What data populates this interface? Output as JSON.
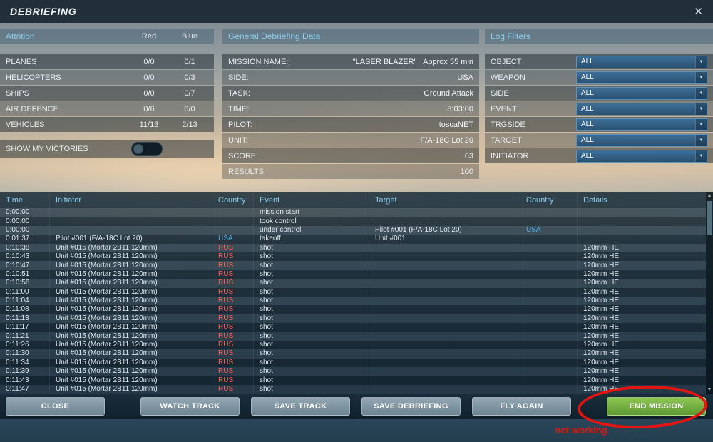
{
  "window": {
    "title": "DEBRIEFING",
    "close_icon": "✕"
  },
  "attrition": {
    "header": "Attrition",
    "columns": {
      "red": "Red",
      "blue": "Blue"
    },
    "rows": [
      {
        "label": "PLANES",
        "red": "0/0",
        "blue": "0/1"
      },
      {
        "label": "HELICOPTERS",
        "red": "0/0",
        "blue": "0/3"
      },
      {
        "label": "SHIPS",
        "red": "0/0",
        "blue": "0/7"
      },
      {
        "label": "AIR DEFENCE",
        "red": "0/6",
        "blue": "0/0"
      },
      {
        "label": "VEHICLES",
        "red": "11/13",
        "blue": "2/13"
      }
    ],
    "show_my_victories_label": "SHOW MY VICTORIES",
    "show_my_victories_on": false
  },
  "general": {
    "header": "General Debriefing Data",
    "rows": [
      {
        "label": "MISSION NAME:",
        "value": "\"LASER BLAZER\"   Approx 55 min"
      },
      {
        "label": "SIDE:",
        "value": "USA"
      },
      {
        "label": "TASK:",
        "value": "Ground Attack"
      },
      {
        "label": "TIME:",
        "value": "8:03:00"
      },
      {
        "label": "PILOT:",
        "value": "toscaNET"
      },
      {
        "label": "UNIT:",
        "value": "F/A-18C Lot 20"
      },
      {
        "label": "SCORE:",
        "value": "63"
      },
      {
        "label": "RESULTS",
        "value": "100"
      }
    ]
  },
  "log_filters": {
    "header": "Log Filters",
    "dropdown_arrow": "▼",
    "filters": [
      {
        "label": "OBJECT",
        "value": "ALL"
      },
      {
        "label": "WEAPON",
        "value": "ALL"
      },
      {
        "label": "SIDE",
        "value": "ALL"
      },
      {
        "label": "EVENT",
        "value": "ALL"
      },
      {
        "label": "TRGSIDE",
        "value": "ALL"
      },
      {
        "label": "TARGET",
        "value": "ALL"
      },
      {
        "label": "INITIATOR",
        "value": "ALL"
      }
    ]
  },
  "log_table": {
    "columns": [
      "Time",
      "Initiator",
      "Country",
      "Event",
      "Target",
      "Country",
      "Details"
    ],
    "scroll_up_icon": "▲",
    "scroll_down_icon": "▼",
    "rows": [
      [
        "0:00:00",
        "",
        "",
        "mission start",
        "",
        "",
        ""
      ],
      [
        "0:00:00",
        "",
        "",
        "took control",
        "",
        "",
        ""
      ],
      [
        "0:00:00",
        "",
        "",
        "under control",
        "Pilot #001 (F/A-18C Lot 20)",
        "USA",
        ""
      ],
      [
        "0:01:37",
        "Pilot #001 (F/A-18C Lot 20)",
        "USA",
        "takeoff",
        "Unit #001",
        "",
        ""
      ],
      [
        "0:10:38",
        "Unit #015 (Mortar 2B11 120mm)",
        "RUS",
        "shot",
        "",
        "",
        "120mm HE"
      ],
      [
        "0:10:43",
        "Unit #015 (Mortar 2B11 120mm)",
        "RUS",
        "shot",
        "",
        "",
        "120mm HE"
      ],
      [
        "0:10:47",
        "Unit #015 (Mortar 2B11 120mm)",
        "RUS",
        "shot",
        "",
        "",
        "120mm HE"
      ],
      [
        "0:10:51",
        "Unit #015 (Mortar 2B11 120mm)",
        "RUS",
        "shot",
        "",
        "",
        "120mm HE"
      ],
      [
        "0:10:56",
        "Unit #015 (Mortar 2B11 120mm)",
        "RUS",
        "shot",
        "",
        "",
        "120mm HE"
      ],
      [
        "0:11:00",
        "Unit #015 (Mortar 2B11 120mm)",
        "RUS",
        "shot",
        "",
        "",
        "120mm HE"
      ],
      [
        "0:11:04",
        "Unit #015 (Mortar 2B11 120mm)",
        "RUS",
        "shot",
        "",
        "",
        "120mm HE"
      ],
      [
        "0:11:08",
        "Unit #015 (Mortar 2B11 120mm)",
        "RUS",
        "shot",
        "",
        "",
        "120mm HE"
      ],
      [
        "0:11:13",
        "Unit #015 (Mortar 2B11 120mm)",
        "RUS",
        "shot",
        "",
        "",
        "120mm HE"
      ],
      [
        "0:11:17",
        "Unit #015 (Mortar 2B11 120mm)",
        "RUS",
        "shot",
        "",
        "",
        "120mm HE"
      ],
      [
        "0:11:21",
        "Unit #015 (Mortar 2B11 120mm)",
        "RUS",
        "shot",
        "",
        "",
        "120mm HE"
      ],
      [
        "0:11:26",
        "Unit #015 (Mortar 2B11 120mm)",
        "RUS",
        "shot",
        "",
        "",
        "120mm HE"
      ],
      [
        "0:11:30",
        "Unit #015 (Mortar 2B11 120mm)",
        "RUS",
        "shot",
        "",
        "",
        "120mm HE"
      ],
      [
        "0:11:34",
        "Unit #015 (Mortar 2B11 120mm)",
        "RUS",
        "shot",
        "",
        "",
        "120mm HE"
      ],
      [
        "0:11:39",
        "Unit #015 (Mortar 2B11 120mm)",
        "RUS",
        "shot",
        "",
        "",
        "120mm HE"
      ],
      [
        "0:11:43",
        "Unit #015 (Mortar 2B11 120mm)",
        "RUS",
        "shot",
        "",
        "",
        "120mm HE"
      ],
      [
        "0:11:47",
        "Unit #015 (Mortar 2B11 120mm)",
        "RUS",
        "shot",
        "",
        "",
        "120mm HE"
      ]
    ]
  },
  "buttons": [
    {
      "label": "CLOSE"
    },
    {
      "label": "WATCH TRACK"
    },
    {
      "label": "SAVE TRACK"
    },
    {
      "label": "SAVE DEBRIEFING"
    },
    {
      "label": "FLY AGAIN"
    },
    {
      "label": "END MISSION"
    }
  ],
  "annotation": {
    "text": "not working"
  },
  "colors": {
    "header_accent": "#8ccdef",
    "usa": "#4fb0ec",
    "rus": "#ff6250",
    "end_mission_green": "#5c9a31",
    "annotation_red": "#e41410"
  }
}
